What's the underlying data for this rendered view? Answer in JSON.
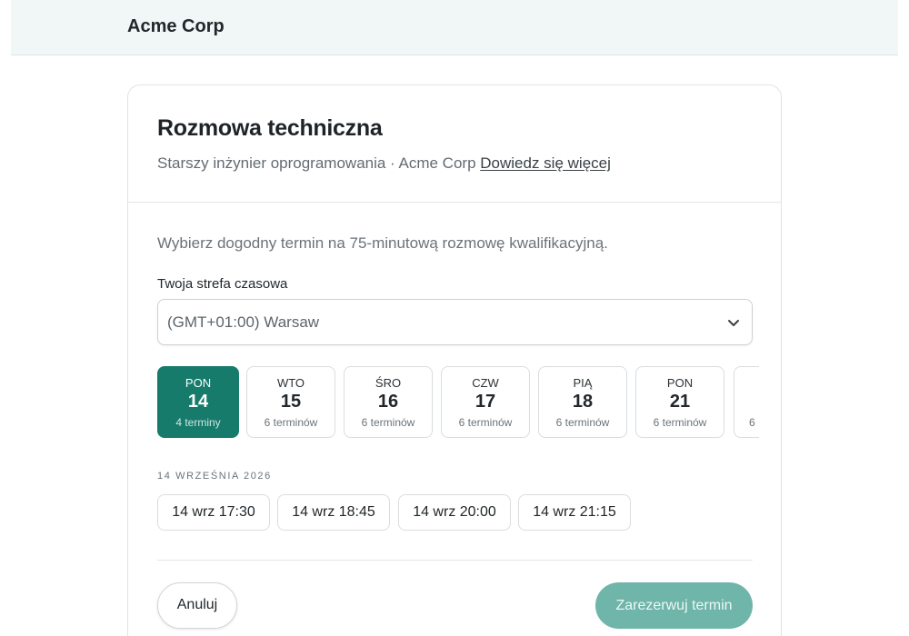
{
  "brand": "Acme Corp",
  "card": {
    "title": "Rozmowa techniczna",
    "subtitle_text": "Starszy inżynier oprogramowania · Acme Corp",
    "learn_more": "Dowiedz się więcej",
    "intro": "Wybierz dogodny termin na 75-minutową rozmowę kwalifikacyjną.",
    "timezone": {
      "label": "Twoja strefa czasowa",
      "value": "(GMT+01:00) Warsaw"
    },
    "days": [
      {
        "dow": "PON",
        "num": "14",
        "count": "4 terminy",
        "selected": true
      },
      {
        "dow": "WTO",
        "num": "15",
        "count": "6 terminów",
        "selected": false
      },
      {
        "dow": "ŚRO",
        "num": "16",
        "count": "6 terminów",
        "selected": false
      },
      {
        "dow": "CZW",
        "num": "17",
        "count": "6 terminów",
        "selected": false
      },
      {
        "dow": "PIĄ",
        "num": "18",
        "count": "6 terminów",
        "selected": false
      },
      {
        "dow": "PON",
        "num": "21",
        "count": "6 terminów",
        "selected": false
      },
      {
        "dow": "",
        "num": "",
        "count": "6",
        "selected": false
      }
    ],
    "date_heading": "14 WRZEŚNIA 2026",
    "slots": [
      "14 wrz 17:30",
      "14 wrz 18:45",
      "14 wrz 20:00",
      "14 wrz 21:15"
    ],
    "cancel_label": "Anuluj",
    "book_label": "Zarezerwuj termin"
  },
  "colors": {
    "accent": "#167b6b",
    "accent_disabled": "#6fb5aa",
    "topbar_bg": "#f1f6f6"
  }
}
